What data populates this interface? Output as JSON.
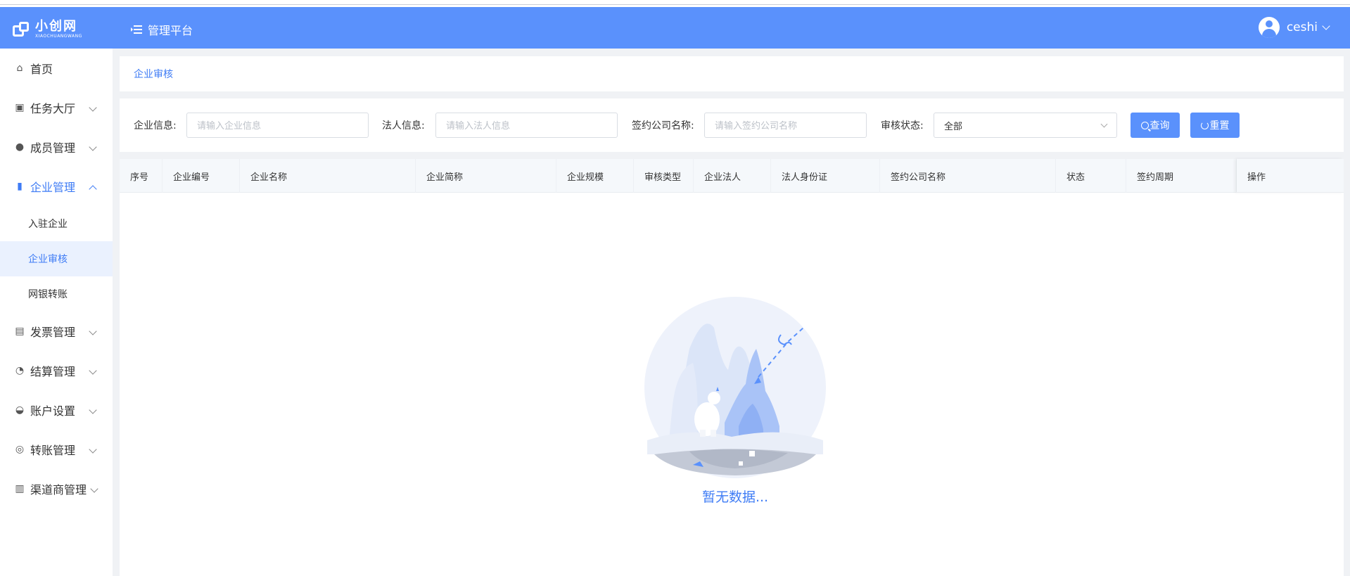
{
  "app": {
    "logo_cn": "小创网",
    "logo_en": "XIAOCHUANGWANG",
    "platform_title": "管理平台",
    "user_name": "ceshi"
  },
  "sidebar": {
    "items": [
      {
        "label": "首页",
        "icon": "home-icon"
      },
      {
        "label": "任务大厅",
        "icon": "calendar-icon",
        "expandable": true
      },
      {
        "label": "成员管理",
        "icon": "users-icon",
        "expandable": true
      },
      {
        "label": "企业管理",
        "icon": "building-icon",
        "expandable": true,
        "open": true,
        "children": [
          {
            "label": "入驻企业"
          },
          {
            "label": "企业审核",
            "active": true
          },
          {
            "label": "网银转账"
          }
        ]
      },
      {
        "label": "发票管理",
        "icon": "invoice-icon",
        "expandable": true
      },
      {
        "label": "结算管理",
        "icon": "settle-icon",
        "expandable": true
      },
      {
        "label": "账户设置",
        "icon": "account-icon",
        "expandable": true
      },
      {
        "label": "转账管理",
        "icon": "transfer-icon",
        "expandable": true
      },
      {
        "label": "渠道商管理",
        "icon": "channel-icon",
        "expandable": true
      }
    ]
  },
  "breadcrumb": "企业审核",
  "filters": {
    "company_info_label": "企业信息:",
    "company_info_placeholder": "请输入企业信息",
    "legal_info_label": "法人信息:",
    "legal_info_placeholder": "请输入法人信息",
    "contract_company_label": "签约公司名称:",
    "contract_company_placeholder": "请输入签约公司名称",
    "audit_status_label": "审核状态:",
    "audit_status_value": "全部",
    "query_button": "查询",
    "reset_button": "重置"
  },
  "table": {
    "columns": [
      "序号",
      "企业编号",
      "企业名称",
      "企业简称",
      "企业规模",
      "审核类型",
      "企业法人",
      "法人身份证",
      "签约公司名称",
      "状态",
      "签约周期",
      "操作"
    ],
    "rows": []
  },
  "empty_text": "暂无数据...",
  "colors": {
    "header": "#5a91fc",
    "accent": "#3f7cf5",
    "active_bg": "#eaf1fe"
  }
}
